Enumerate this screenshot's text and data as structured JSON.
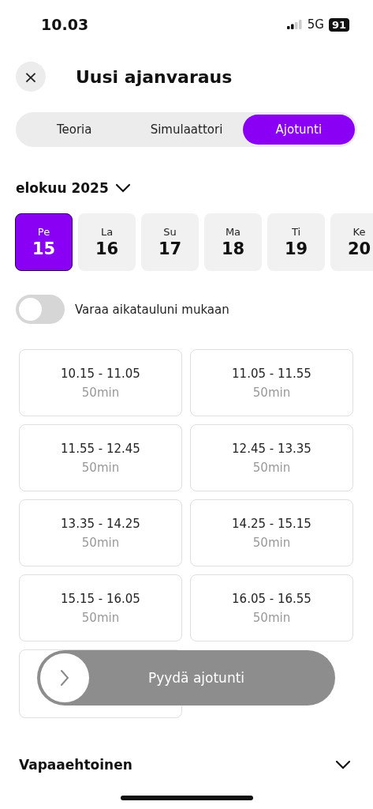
{
  "status_bar": {
    "time": "10.03",
    "network": "5G",
    "battery": "91"
  },
  "header": {
    "close": "×",
    "title": "Uusi ajanvaraus"
  },
  "tabs": [
    {
      "label": "Teoria",
      "selected": false
    },
    {
      "label": "Simulaattori",
      "selected": false
    },
    {
      "label": "Ajotunti",
      "selected": true
    }
  ],
  "month": {
    "label": "elokuu 2025",
    "expanded": false
  },
  "days": [
    {
      "weekday": "Pe",
      "day": "15",
      "selected": true
    },
    {
      "weekday": "La",
      "day": "16",
      "selected": false
    },
    {
      "weekday": "Su",
      "day": "17",
      "selected": false
    },
    {
      "weekday": "Ma",
      "day": "18",
      "selected": false
    },
    {
      "weekday": "Ti",
      "day": "19",
      "selected": false
    },
    {
      "weekday": "Ke",
      "day": "20",
      "selected": false
    }
  ],
  "schedule_toggle": {
    "label": "Varaa aikatauluni mukaan",
    "on": false
  },
  "slots": [
    {
      "kind": "full",
      "time": "10.15 - 11.05",
      "duration": "50min"
    },
    {
      "kind": "full",
      "time": "11.05 - 11.55",
      "duration": "50min"
    },
    {
      "kind": "full",
      "time": "11.55 - 12.45",
      "duration": "50min"
    },
    {
      "kind": "full",
      "time": "12.45 - 13.35",
      "duration": "50min"
    },
    {
      "kind": "full",
      "time": "13.35 - 14.25",
      "duration": "50min"
    },
    {
      "kind": "full",
      "time": "14.25 - 15.15",
      "duration": "50min"
    },
    {
      "kind": "full",
      "time": "15.15 - 16.05",
      "duration": "50min"
    },
    {
      "kind": "full",
      "time": "16.05 - 16.55",
      "duration": "50min"
    },
    {
      "kind": "covered"
    }
  ],
  "request_button": {
    "label": "Pyydä ajotunti",
    "disabled": true
  },
  "optional_section": {
    "title": "Vapaaehtoinen",
    "expanded": false
  }
}
